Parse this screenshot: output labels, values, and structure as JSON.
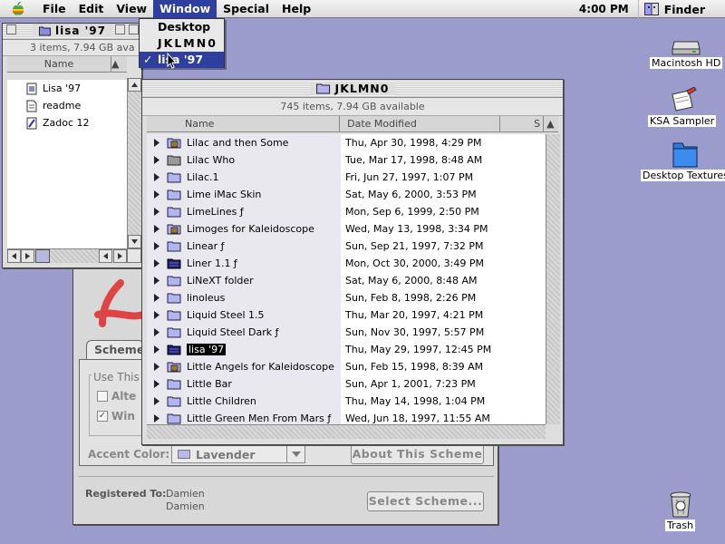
{
  "menubar": {
    "items": [
      "File",
      "Edit",
      "View",
      "Window",
      "Special",
      "Help"
    ],
    "active": "Window",
    "clock": "4:00 PM",
    "app": "Finder"
  },
  "window_menu": {
    "items": [
      "Desktop",
      "JKLMN0",
      "lisa '97"
    ],
    "checked": "lisa '97"
  },
  "lisa_window": {
    "title": "lisa '97",
    "status": "3 items, 7.94 GB ava",
    "column": "Name",
    "items": [
      {
        "name": "Lisa '97",
        "icon": "app-icon"
      },
      {
        "name": "readme",
        "icon": "document-icon"
      },
      {
        "name": "Zadoc 12",
        "icon": "app-alias-icon"
      }
    ]
  },
  "jk_window": {
    "title": "JKLMN0",
    "status": "745 items, 7.94 GB available",
    "columns": [
      "Name",
      "Date Modified",
      "S"
    ],
    "rows": [
      {
        "name": "Lilac and then Some",
        "date": "Thu, Apr 30, 1998, 4:29 PM",
        "icon": "folder-special"
      },
      {
        "name": "Lilac Who",
        "date": "Tue, Mar 17, 1998, 8:48 AM",
        "icon": "folder-gray"
      },
      {
        "name": "Lilac.1",
        "date": "Fri, Jun 27, 1997, 1:07 PM",
        "icon": "folder"
      },
      {
        "name": "Lime iMac Skin",
        "date": "Sat, May 6, 2000, 3:53 PM",
        "icon": "folder"
      },
      {
        "name": "LimeLines ƒ",
        "date": "Mon, Sep 6, 1999, 2:50 PM",
        "icon": "folder"
      },
      {
        "name": "Limoges for Kaleidoscope",
        "date": "Wed, May 13, 1998, 3:34 PM",
        "icon": "folder-special"
      },
      {
        "name": "Linear ƒ",
        "date": "Sun, Sep 21, 1997, 7:32 PM",
        "icon": "folder"
      },
      {
        "name": "Liner 1.1 ƒ",
        "date": "Mon, Oct 30, 2000, 3:49 PM",
        "icon": "folder-dark"
      },
      {
        "name": "LiNeXT folder",
        "date": "Sat, May 6, 2000, 8:48 AM",
        "icon": "folder"
      },
      {
        "name": "linoleus",
        "date": "Sun, Feb 8, 1998, 2:26 PM",
        "icon": "folder"
      },
      {
        "name": "Liquid Steel 1.5",
        "date": "Thu, Mar 20, 1997, 4:21 PM",
        "icon": "folder"
      },
      {
        "name": "Liquid Steel Dark ƒ",
        "date": "Sun, Nov 30, 1997, 5:57 PM",
        "icon": "folder"
      },
      {
        "name": "lisa '97",
        "date": "Thu, May 29, 1997, 12:45 PM",
        "icon": "folder-dark",
        "selected": true
      },
      {
        "name": "Little Angels for Kaleidoscope",
        "date": "Sun, Feb 15, 1998, 8:39 AM",
        "icon": "folder-special"
      },
      {
        "name": "Little Bar",
        "date": "Sun, Apr 1, 2001, 7:23 PM",
        "icon": "folder"
      },
      {
        "name": "Little Children",
        "date": "Thu, May 14, 1998, 1:04 PM",
        "icon": "folder"
      },
      {
        "name": "Little Green Men From Mars ƒ",
        "date": "Wed, Jun 18, 1997, 11:55 AM",
        "icon": "folder"
      }
    ]
  },
  "appearance": {
    "tab": "Scheme",
    "group_label": "Use This",
    "checkbox1": "Alte",
    "checkbox2": "Win",
    "accent_label": "Accent Color:",
    "accent_value": "Lavender",
    "about_button": "About This Scheme",
    "registered_label": "Registered To:",
    "registered_name1": "Damien",
    "registered_name2": "Damien",
    "select_button": "Select Scheme..."
  },
  "desktop": {
    "hd": "Macintosh HD",
    "ksa": "KSA Sampler",
    "textures": "Desktop Textures",
    "trash": "Trash"
  },
  "colors": {
    "desktop": "#9c9ccc",
    "highlight": "#2e3fa0",
    "folder": "#b4b4f0"
  }
}
